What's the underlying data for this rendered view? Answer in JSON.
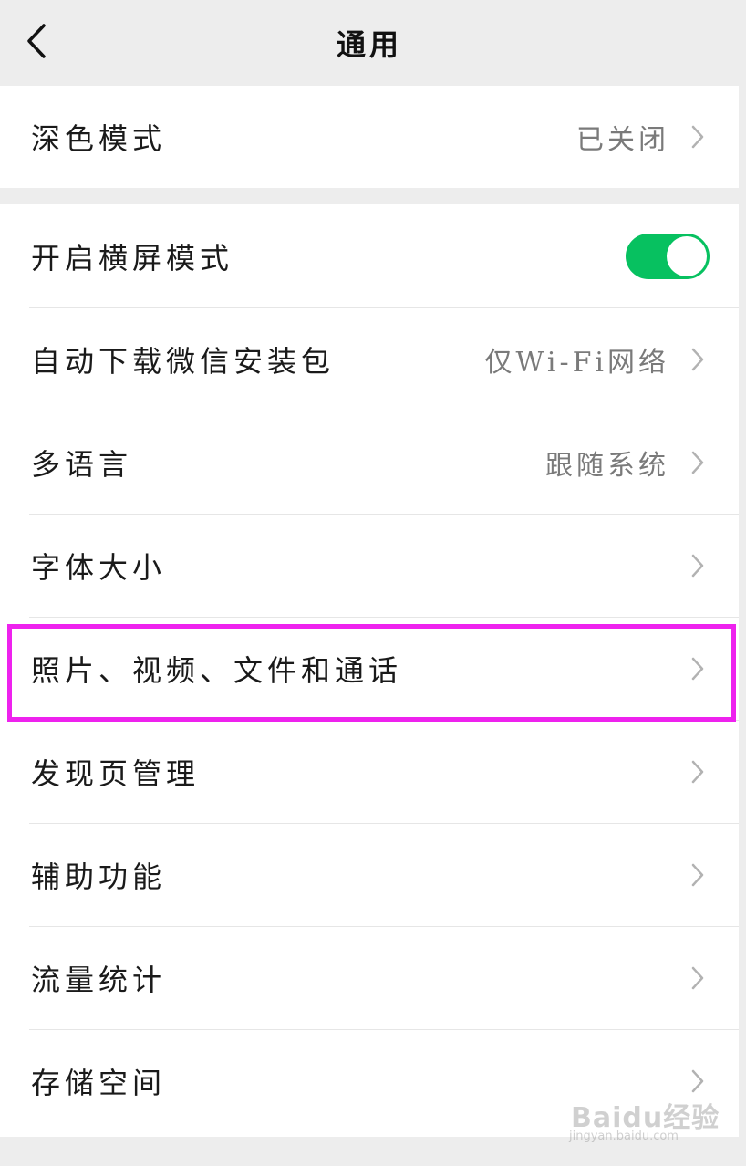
{
  "header": {
    "title": "通用",
    "back_icon": "chevron-left-icon"
  },
  "groups": [
    {
      "rows": [
        {
          "label": "深色模式",
          "value": "已关闭",
          "control": "chevron"
        }
      ]
    },
    {
      "rows": [
        {
          "label": "开启横屏模式",
          "value": "",
          "control": "toggle",
          "toggle_on": true
        },
        {
          "label": "自动下载微信安装包",
          "value": "仅Wi-Fi网络",
          "control": "chevron"
        },
        {
          "label": "多语言",
          "value": "跟随系统",
          "control": "chevron"
        },
        {
          "label": "字体大小",
          "value": "",
          "control": "chevron"
        },
        {
          "label": "照片、视频、文件和通话",
          "value": "",
          "control": "chevron",
          "highlighted": true
        },
        {
          "label": "发现页管理",
          "value": "",
          "control": "chevron"
        },
        {
          "label": "辅助功能",
          "value": "",
          "control": "chevron"
        },
        {
          "label": "流量统计",
          "value": "",
          "control": "chevron"
        },
        {
          "label": "存储空间",
          "value": "",
          "control": "chevron"
        }
      ]
    }
  ],
  "colors": {
    "toggle_on": "#07c160",
    "highlight_border": "#ee22ee",
    "background": "#ededed"
  },
  "watermark": {
    "brand": "Baidu经验",
    "url": "jingyan.baidu.com"
  }
}
